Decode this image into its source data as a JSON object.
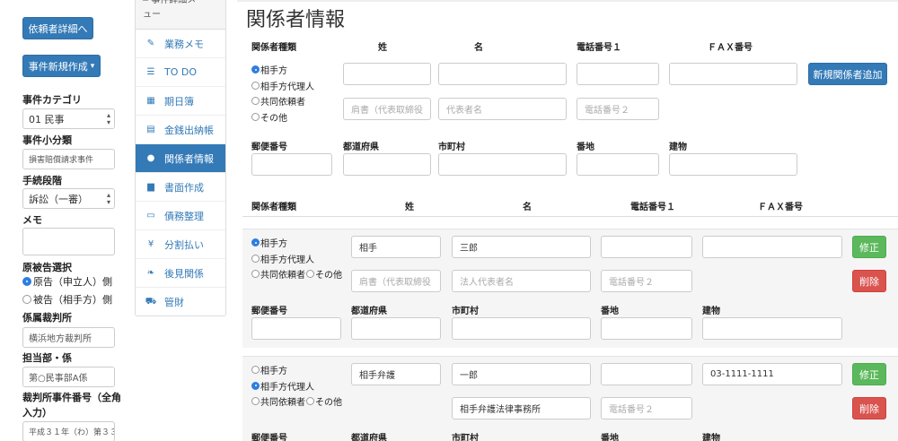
{
  "left": {
    "client_detail_button": "依頼者詳細へ",
    "new_case_button": "事件新規作成",
    "new_case_caret": "▾",
    "case_category_label": "事件カテゴリ",
    "case_category_value": "01 民事",
    "case_subcategory_label": "事件小分類",
    "case_subcategory_value": "損害賠償請求事件",
    "procedure_stage_label": "手続段階",
    "procedure_stage_value": "訴訟（一審）",
    "memo_label": "メモ",
    "party_select_label": "原被告選択",
    "party_options": [
      "原告（申立人）側",
      "被告（相手方）側"
    ],
    "court_label": "係属裁判所",
    "court_value": "横浜地方裁判所",
    "division_label": "担当部・係",
    "division_value": "第○民事部A係",
    "case_number_label_1": "裁判所事件番号（全角",
    "case_number_label_2": "入力）",
    "case_number_value": "平成３１年（わ）第３３"
  },
  "menu": {
    "header": "事件詳細メニュー",
    "header_cut_top": "━ 事件詳細メ",
    "header_cut_bottom": "ュー",
    "items": [
      {
        "icon": "✎",
        "label": "業務メモ"
      },
      {
        "icon": "☰",
        "label": "TO DO"
      },
      {
        "icon": "▦",
        "label": "期日簿"
      },
      {
        "icon": "▤",
        "label": "金銭出納帳"
      },
      {
        "icon": "●",
        "label": "関係者情報"
      },
      {
        "icon": "▆",
        "label": "書面作成"
      },
      {
        "icon": "▭",
        "label": "債務整理"
      },
      {
        "icon": "¥",
        "label": "分割払い"
      },
      {
        "icon": "❧",
        "label": "後見関係"
      },
      {
        "icon": "⛟",
        "label": "管財"
      }
    ]
  },
  "main": {
    "title": "関係者情報",
    "col_headers": {
      "type": "関係者種類",
      "last_name": "姓",
      "first_name": "名",
      "phone1": "電話番号１",
      "fax": "ＦＡＸ番号"
    },
    "radio_labels": [
      "相手方",
      "相手方代理人",
      "共同依頼者",
      "その他"
    ],
    "address_labels": {
      "postal": "郵便番号",
      "prefecture": "都道府県",
      "city": "市町村",
      "street": "番地",
      "building": "建物"
    },
    "new_form": {
      "title_placeholder": "肩書（代表取締役",
      "rep_placeholder": "代表者名",
      "phone2_placeholder": "電話番号２",
      "add_button": "新規関係者追加"
    },
    "records": [
      {
        "selected_type": 0,
        "last_name": "相手",
        "first_name": "三郎",
        "phone1": "",
        "fax": "",
        "title_placeholder": "肩書（代表取締役",
        "rep_placeholder": "法人代表者名",
        "phone2_placeholder": "電話番号２",
        "edit_button": "修正",
        "delete_button": "削除"
      },
      {
        "selected_type": 1,
        "last_name": "相手弁護",
        "first_name": "一郎",
        "phone1": "",
        "fax": "03-1111-1111",
        "firm_name": "相手弁護法律事務所",
        "phone2_placeholder": "電話番号２",
        "edit_button": "修正",
        "delete_button": "削除"
      }
    ]
  }
}
